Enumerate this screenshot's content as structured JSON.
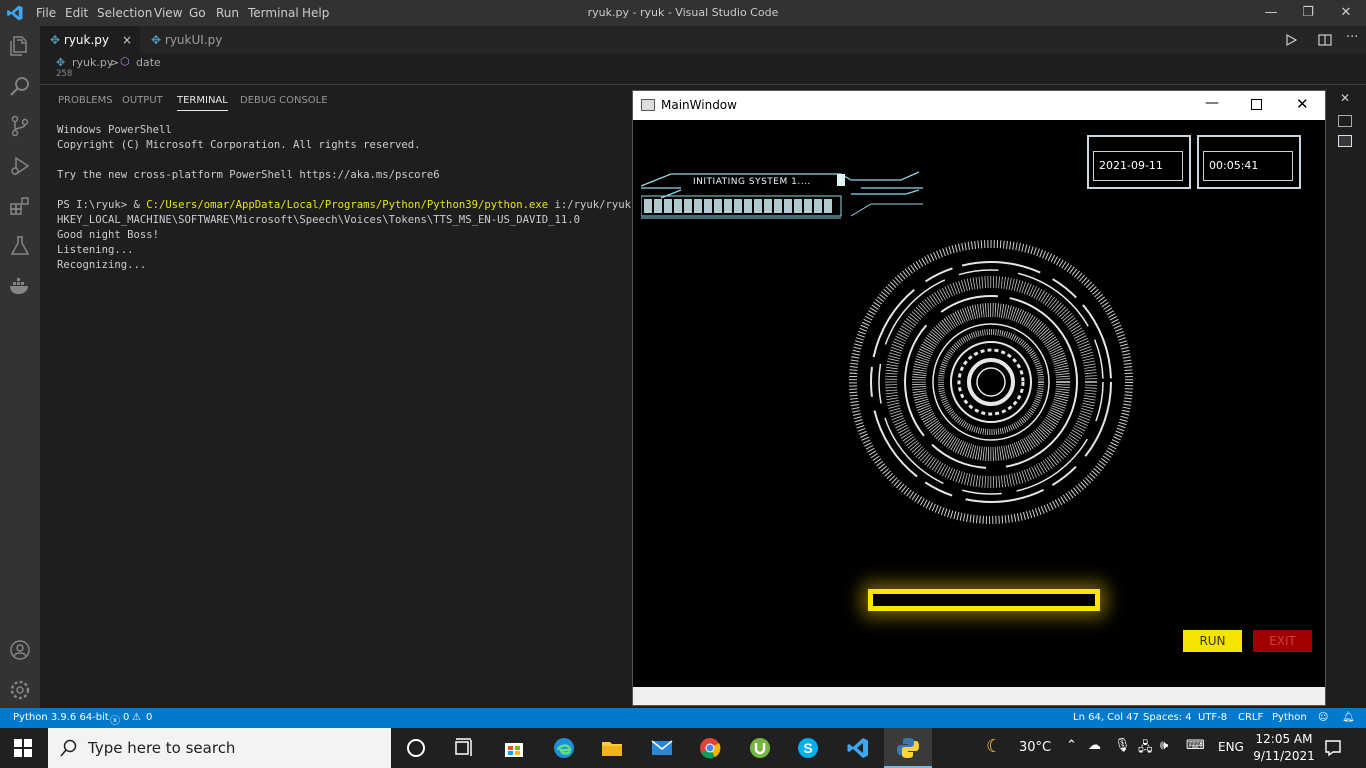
{
  "vscode": {
    "window_title": "ryuk.py - ryuk - Visual Studio Code",
    "menu": [
      "File",
      "Edit",
      "Selection",
      "View",
      "Go",
      "Run",
      "Terminal",
      "Help"
    ],
    "tabs": [
      {
        "label": "ryuk.py",
        "close": "×"
      },
      {
        "label": "ryukUI.py"
      }
    ],
    "breadcrumb": {
      "file": "ryuk.py",
      "sep": ">",
      "symbol": "date"
    },
    "visible_line_number": "258",
    "panel_tabs": [
      "PROBLEMS",
      "OUTPUT",
      "TERMINAL",
      "DEBUG CONSOLE"
    ],
    "terminal": {
      "line1": "Windows PowerShell",
      "line2": "Copyright (C) Microsoft Corporation. All rights reserved.",
      "line3": "Try the new cross-platform PowerShell https://aka.ms/pscore6",
      "prompt": "PS I:\\ryuk> & ",
      "exe_path": "C:/Users/omar/AppData/Local/Programs/Python/Python39/python.exe",
      "script_arg": " i:/ryuk/ryuk.py",
      "line5": "HKEY_LOCAL_MACHINE\\SOFTWARE\\Microsoft\\Speech\\Voices\\Tokens\\TTS_MS_EN-US_DAVID_11.0",
      "line6": "Good night Boss!",
      "line7": "Listening...",
      "line8": "Recognizing..."
    },
    "status": {
      "python": "Python 3.9.6 64-bit",
      "errors": "0",
      "warnings": "0",
      "position": "Ln 64, Col 47",
      "spaces": "Spaces: 4",
      "encoding": "UTF-8",
      "eol": "CRLF",
      "language": "Python"
    },
    "colors": {
      "status_bar": "#007acc",
      "terminal_yellow": "#e5e510",
      "title_bar": "#323233",
      "activity_bar": "#333333"
    }
  },
  "main_window": {
    "title": "MainWindow",
    "initiating_text": "INITIATING SYSTEM 1....",
    "date": "2021-09-11",
    "time": "00:05:41",
    "run_label": "RUN",
    "exit_label": "EXIT",
    "colors": {
      "run": "#f5e400",
      "exit": "#a00000",
      "glow": "#ffe600"
    }
  },
  "taskbar": {
    "search_placeholder": "Type here to search",
    "weather_temp": "30°C",
    "language": "ENG",
    "clock_time": "12:05 AM",
    "clock_date": "9/11/2021",
    "icons": [
      "cortana-icon",
      "task-view-icon",
      "store-icon",
      "edge-icon",
      "file-explorer-icon",
      "mail-icon",
      "chrome-icon",
      "utorrent-icon",
      "skype-icon",
      "vscode-icon",
      "python-icon"
    ]
  }
}
